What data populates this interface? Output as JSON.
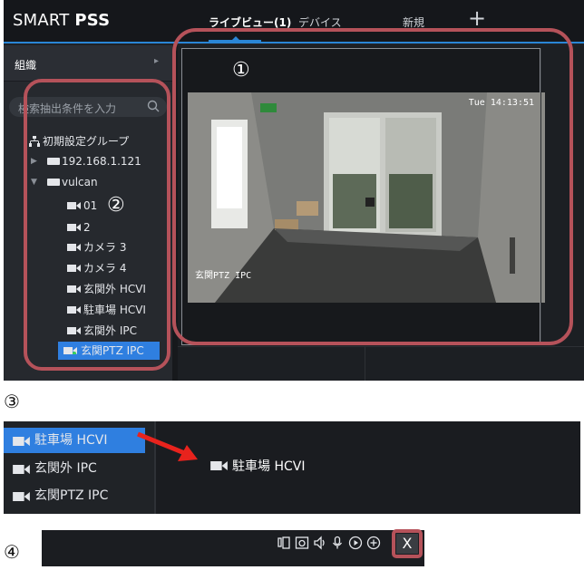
{
  "app": {
    "logo_light": "SMART ",
    "logo_bold": "PSS",
    "tabs": [
      {
        "label": "ライブビュー(1)",
        "active": true
      },
      {
        "label": "デバイス",
        "active": false
      },
      {
        "label": "新規",
        "active": false
      }
    ],
    "add_tab": "+"
  },
  "sidebar": {
    "org_label": "組織",
    "search_placeholder": "検索抽出条件を入力",
    "tree": [
      {
        "label": "初期設定グループ",
        "icon": "group-icon"
      },
      {
        "label": "192.168.1.121",
        "icon": "device-icon"
      },
      {
        "label": "vulcan",
        "icon": "device-icon"
      },
      {
        "label": "01",
        "icon": "camera-icon"
      },
      {
        "label": "2",
        "icon": "camera-icon"
      },
      {
        "label": "カメラ 3",
        "icon": "camera-icon"
      },
      {
        "label": "カメラ 4",
        "icon": "camera-icon"
      },
      {
        "label": "玄関外 HCVI",
        "icon": "camera-icon"
      },
      {
        "label": "駐車場 HCVI",
        "icon": "camera-icon"
      },
      {
        "label": "玄関外 IPC",
        "icon": "camera-icon"
      },
      {
        "label": "玄関PTZ IPC",
        "icon": "camera-icon",
        "selected": true
      }
    ]
  },
  "video": {
    "timestamp": "Tue 14:13:51",
    "channel_name": "玄関PTZ IPC"
  },
  "annotations": {
    "n1": "①",
    "n2": "②",
    "n3": "③",
    "n4": "④"
  },
  "panel3": {
    "list": [
      {
        "label": "駐車場 HCVI",
        "selected": true
      },
      {
        "label": "玄関外 IPC",
        "selected": false
      },
      {
        "label": "玄関PTZ IPC",
        "selected": false
      }
    ],
    "dropped_label": "駐車場 HCVI"
  },
  "panel4": {
    "toolbar_icons": [
      "tilt-icon",
      "snapshot-icon",
      "audio-icon",
      "talk-icon",
      "record-icon",
      "zoom-icon"
    ],
    "close_label": "X"
  },
  "colors": {
    "accent": "#2a86d6",
    "selection": "#2f7fe0",
    "annotation": "#b5525a",
    "arrow": "#e8231d"
  }
}
